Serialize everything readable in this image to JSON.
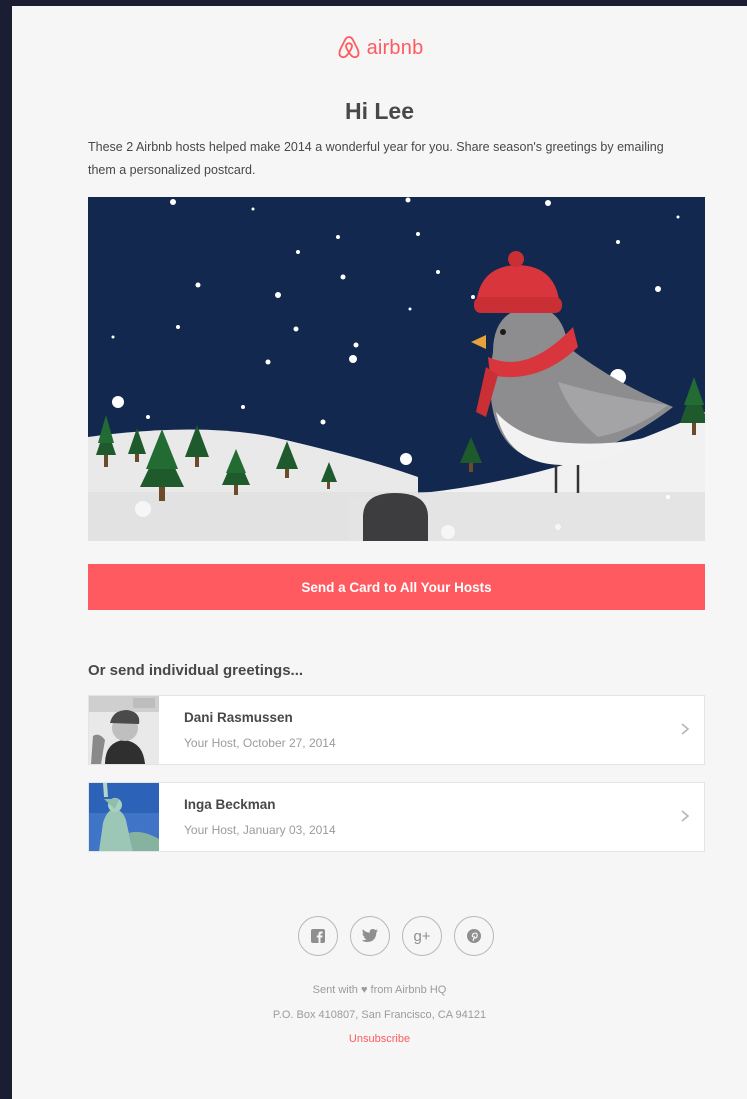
{
  "brand": {
    "name": "airbnb",
    "color": "#ff5a5f",
    "logo_icon": "airbnb-belo-icon"
  },
  "greeting": "Hi Lee",
  "intro": "These 2 Airbnb hosts helped make 2014 a wonderful year for you. Share season's greetings by emailing them a personalized postcard.",
  "hero": {
    "icon": "winter-bird-illustration",
    "sky_color": "#12284f",
    "accent_color": "#e0353c"
  },
  "cta_label": "Send a Card to All Your Hosts",
  "subhead": "Or send individual greetings...",
  "hosts": [
    {
      "name": "Dani Rasmussen",
      "meta": "Your Host, October 27, 2014",
      "photo": "host-photo-portrait"
    },
    {
      "name": "Inga Beckman",
      "meta": "Your Host, January 03, 2014",
      "photo": "host-photo-statue-of-liberty"
    }
  ],
  "social": [
    "facebook-icon",
    "twitter-icon",
    "google-plus-icon",
    "pinterest-icon"
  ],
  "footer": {
    "sent_with": "Sent with ♥ from Airbnb HQ",
    "address": "P.O. Box 410807, San Francisco, CA 94121",
    "unsubscribe": "Unsubscribe"
  }
}
